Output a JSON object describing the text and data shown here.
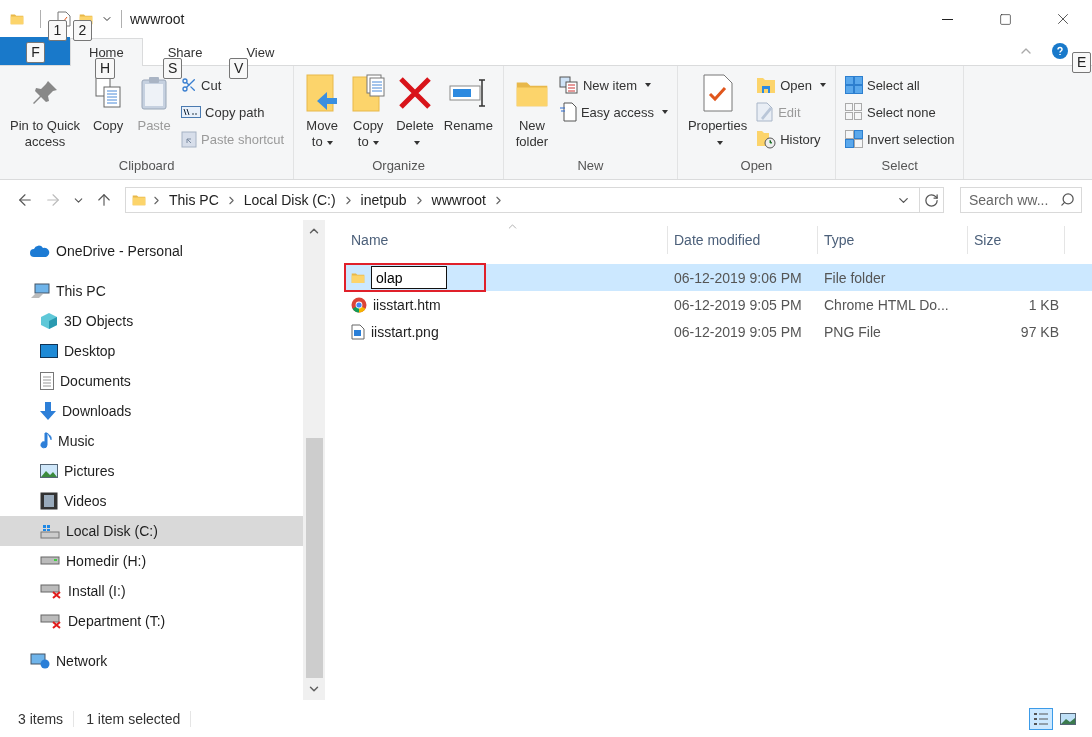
{
  "window": {
    "title": "wwwroot"
  },
  "quick_access_keytips": [
    "1",
    "2"
  ],
  "ribbon": {
    "file_keytip": "F",
    "tabs": [
      {
        "label": "Home",
        "keytip": "H",
        "selected": true
      },
      {
        "label": "Share",
        "keytip": "S",
        "selected": false
      },
      {
        "label": "View",
        "keytip": "V",
        "selected": false
      }
    ],
    "side_keytip": "E",
    "groups": [
      {
        "label": "Clipboard",
        "items": [
          {
            "kind": "large",
            "lines": [
              "Pin to Quick",
              "access"
            ],
            "disabled": false,
            "dropdown": false
          },
          {
            "kind": "large",
            "lines": [
              "Copy"
            ],
            "disabled": false,
            "dropdown": false
          },
          {
            "kind": "large",
            "lines": [
              "Paste"
            ],
            "disabled": true,
            "dropdown": false
          },
          {
            "kind": "small",
            "lines": [
              "Cut"
            ],
            "disabled": false,
            "dropdown": false
          },
          {
            "kind": "small",
            "lines": [
              "Copy path"
            ],
            "disabled": false,
            "dropdown": false
          },
          {
            "kind": "small",
            "lines": [
              "Paste shortcut"
            ],
            "disabled": true,
            "dropdown": false
          }
        ]
      },
      {
        "label": "Organize",
        "items": [
          {
            "kind": "large",
            "lines": [
              "Move",
              "to"
            ],
            "disabled": false,
            "dropdown": true
          },
          {
            "kind": "large",
            "lines": [
              "Copy",
              "to"
            ],
            "disabled": false,
            "dropdown": true
          },
          {
            "kind": "large",
            "lines": [
              "Delete"
            ],
            "disabled": false,
            "dropdown": true
          },
          {
            "kind": "large",
            "lines": [
              "Rename"
            ],
            "disabled": false,
            "dropdown": false
          }
        ]
      },
      {
        "label": "New",
        "items": [
          {
            "kind": "large",
            "lines": [
              "New",
              "folder"
            ],
            "disabled": false,
            "dropdown": false
          },
          {
            "kind": "small",
            "lines": [
              "New item"
            ],
            "disabled": false,
            "dropdown": true
          },
          {
            "kind": "small",
            "lines": [
              "Easy access"
            ],
            "disabled": false,
            "dropdown": true
          }
        ]
      },
      {
        "label": "Open",
        "items": [
          {
            "kind": "large",
            "lines": [
              "Properties"
            ],
            "disabled": false,
            "dropdown": true
          },
          {
            "kind": "small",
            "lines": [
              "Open"
            ],
            "disabled": false,
            "dropdown": true
          },
          {
            "kind": "small",
            "lines": [
              "Edit"
            ],
            "disabled": true,
            "dropdown": false
          },
          {
            "kind": "small",
            "lines": [
              "History"
            ],
            "disabled": false,
            "dropdown": false
          }
        ]
      },
      {
        "label": "Select",
        "items": [
          {
            "kind": "small",
            "lines": [
              "Select all"
            ],
            "disabled": false,
            "dropdown": false
          },
          {
            "kind": "small",
            "lines": [
              "Select none"
            ],
            "disabled": false,
            "dropdown": false
          },
          {
            "kind": "small",
            "lines": [
              "Invert selection"
            ],
            "disabled": false,
            "dropdown": false
          }
        ]
      }
    ]
  },
  "address": {
    "breadcrumbs": [
      "This PC",
      "Local Disk (C:)",
      "inetpub",
      "wwwroot"
    ],
    "search_placeholder": "Search ww..."
  },
  "navigation": [
    {
      "label": "OneDrive - Personal",
      "selected": false
    },
    {
      "label": "This PC",
      "selected": false,
      "children": [
        {
          "label": "3D Objects",
          "selected": false
        },
        {
          "label": "Desktop",
          "selected": false
        },
        {
          "label": "Documents",
          "selected": false
        },
        {
          "label": "Downloads",
          "selected": false
        },
        {
          "label": "Music",
          "selected": false
        },
        {
          "label": "Pictures",
          "selected": false
        },
        {
          "label": "Videos",
          "selected": false
        },
        {
          "label": "Local Disk (C:)",
          "selected": true
        },
        {
          "label": "Homedir (H:)",
          "selected": false
        },
        {
          "label": "Install (I:)",
          "selected": false
        },
        {
          "label": "Department (T:)",
          "selected": false
        }
      ]
    },
    {
      "label": "Network",
      "selected": false
    }
  ],
  "files": {
    "columns": [
      {
        "label": "Name",
        "sorted": true
      },
      {
        "label": "Date modified",
        "sorted": false
      },
      {
        "label": "Type",
        "sorted": false
      },
      {
        "label": "Size",
        "sorted": false
      }
    ],
    "rows": [
      {
        "name": "olap",
        "date": "06-12-2019 9:06 PM",
        "type": "File folder",
        "selected": true,
        "renaming": true,
        "highlighted": true
      },
      {
        "name": "iisstart.htm",
        "date": "06-12-2019 9:05 PM",
        "type": "Chrome HTML Do...",
        "size": "1 KB",
        "selected": false,
        "renaming": false,
        "highlighted": false
      },
      {
        "name": "iisstart.png",
        "date": "06-12-2019 9:05 PM",
        "type": "PNG File",
        "size": "97 KB",
        "selected": false,
        "renaming": false,
        "highlighted": false
      }
    ]
  },
  "status_bar": {
    "item_count": "3 items",
    "selection": "1 item selected"
  },
  "views": [
    {
      "kind": "details",
      "selected": true
    },
    {
      "kind": "large-icons",
      "selected": false
    }
  ]
}
